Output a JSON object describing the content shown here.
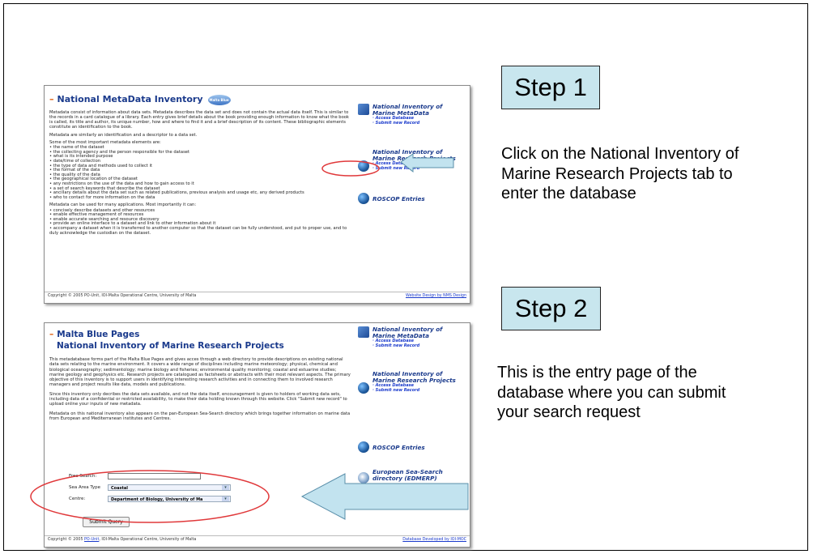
{
  "shot1": {
    "title": "National MetaData Inventory",
    "logo": "Malta Blue Pages",
    "para1": "Metadata consist of information about data sets. Metadata describes the data set and does not contain the actual data itself. This is similar to the records in a card catalogue of a library. Each entry gives brief details about the book providing enough information to know what the book is called, its title and author, its unique number, how and where to find it and a brief description of its content. These bibliographic elements constitute an identification to the book.",
    "para2": "Metadata are similarly an identification and a descriptor to a data set.",
    "para3": "Some of the most important metadata elements are:",
    "bullets1": [
      "the name of the dataset",
      "the collecting agency and the person responsible for the dataset",
      "what is its intended purpose",
      "date/time of collection",
      "the type of data and methods used to collect it",
      "the format of the data",
      "the quality of the data",
      "the geographical location of the dataset",
      "any restrictions on the use of the data and how to gain access to it",
      "a set of search keywords that describe the dataset",
      "ancillary details about the data set such as related publications, previous analysis and usage etc, any derived products",
      "who to contact for more information on the data"
    ],
    "para4": "Metadata can be used for many applications. Most importantly it can:",
    "bullets2": [
      "concisely describe datasets and other resources",
      "enable effective management of resources",
      "enable accurate searching and resource discovery",
      "provide an online interface to a dataset and link to other information about it",
      "accompany a dataset when it is transferred to another computer so that the dataset can be fully understood, and put to proper use, and to duly acknowledge the custodian on the dataset."
    ],
    "side1_title": "National Inventory of Marine MetaData",
    "side1_link1": "· Access Database",
    "side1_link2": "· Submit new Record",
    "side2_title": "National Inventory of Marine Research Projects",
    "side2_link1": "· Access Database",
    "side2_link2": "· Submit new Record",
    "side3_title": "ROSCOP Entries",
    "footer": "Copyright © 2005 PO-Unit, IOI-Malta Operational Centre, University of Malta",
    "footer_right": "Website Design by NMS Design"
  },
  "shot2": {
    "title": "Malta Blue Pages",
    "subtitle": "National Inventory of Marine Research Projects",
    "para1": "This metadatabase forms part of the Malta Blue Pages and gives acces through a web directory to provide descriptions on existing national data sets relating to the marine environment. It covers a wide range of disciplines including marine meteorology; physical, chemical and biological oceanography; sedimentology; marine biology and fisheries; environmental quality monitoring; coastal and estuarine studies; marine geology and geophysics etc. Research projects are catalogued as factsheets or abstracts with their most relevant aspects. The primary objective of this inventory is to support users in identifying interesting research activities and in connecting them to involved research managers and project results like data, models and publications.",
    "para2": "Since this inventory only decribes the data sets available, and not the data itself, encouragement is given to holders of working data sets, including data of a confidential or restricted availability, to make their data holding known through this website. Click \"Submit new record\" to upload online your inputs of new metadata.",
    "para3": "Metadata on this national inventory also appears on the pan-European Sea-Search directory which brings together information on marine data from European and Mediterranean institutes and Centres.",
    "free_search_label": "Free Search:",
    "sea_area_label": "Sea Area Type",
    "sea_area_value": "Coastal",
    "centre_label": "Centre:",
    "centre_value": "Department of Biology, University of Ma",
    "submit_label": "Submit Query",
    "side1_title": "National Inventory of Marine MetaData",
    "side1_link1": "· Access Database",
    "side1_link2": "· Submit new Record",
    "side2_title": "National Inventory of Marine Research Projects",
    "side2_link1": "· Access Database",
    "side2_link2": "· Submit new Record",
    "side3_title": "ROSCOP Entries",
    "side4_title": "European Sea-Search directory (EDMERP)",
    "footer_prefix": "Copyright © 2005 ",
    "footer_link": "PO-Unit",
    "footer_rest": ", IOI-Malta Operational Centre, University of Malta",
    "footer_right": "Database Developed by IOI-MOC"
  },
  "step1": {
    "heading": "Step 1",
    "description": "Click on the National Inventory of Marine Research Projects tab to enter the database"
  },
  "step2": {
    "heading": "Step 2",
    "description": "This is the entry page of the database where you can submit your search request"
  },
  "colors": {
    "step_box": "#c8e6ee",
    "highlight": "#e0383a",
    "arrow_fill": "#c2e3ef",
    "arrow_stroke": "#5a8faa",
    "title_blue": "#1a3a8c",
    "dash_orange": "#e06010"
  },
  "icons": [
    "book-icon",
    "globe-icon",
    "compass-icon",
    "arrow-icon"
  ]
}
